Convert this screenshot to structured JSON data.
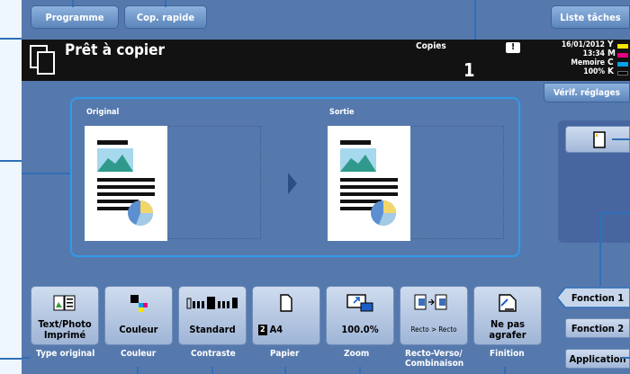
{
  "top_buttons": {
    "programme": "Programme",
    "cop_rapide": "Cop. rapide",
    "liste_taches": "Liste tâches"
  },
  "status": {
    "title": "Prêt à copier",
    "copies_label": "Copies",
    "copies_value": "1",
    "warning_symbol": "!",
    "date": "16/01/2012",
    "time": "13:34",
    "memory_label": "Memoire",
    "memory_value": "100%",
    "toner": [
      "Y",
      "M",
      "C",
      "K"
    ]
  },
  "verif_button": "Vérif. réglages",
  "preview": {
    "original_label": "Original",
    "sortie_label": "Sortie"
  },
  "settings": [
    {
      "label": "Text/Photo\nImprimé",
      "caption": "Type original",
      "icon": "text-photo-icon"
    },
    {
      "label": "Couleur",
      "caption": "Couleur",
      "icon": "color-icon"
    },
    {
      "label": "Standard",
      "caption": "Contraste",
      "icon": "contrast-icon"
    },
    {
      "label": "A4",
      "caption": "Papier",
      "tray": "2",
      "icon": "paper-icon"
    },
    {
      "label": "100.0%",
      "caption": "Zoom",
      "icon": "zoom-icon"
    },
    {
      "label": "Recto > Recto",
      "caption": "Recto-Verso/\nCombinaison",
      "icon": "duplex-icon"
    },
    {
      "label": "Ne pas\nagrafer",
      "caption": "Finition",
      "icon": "staple-icon"
    }
  ],
  "side": {
    "fonction1": "Fonction 1",
    "fonction2": "Fonction 2",
    "application": "Application"
  }
}
